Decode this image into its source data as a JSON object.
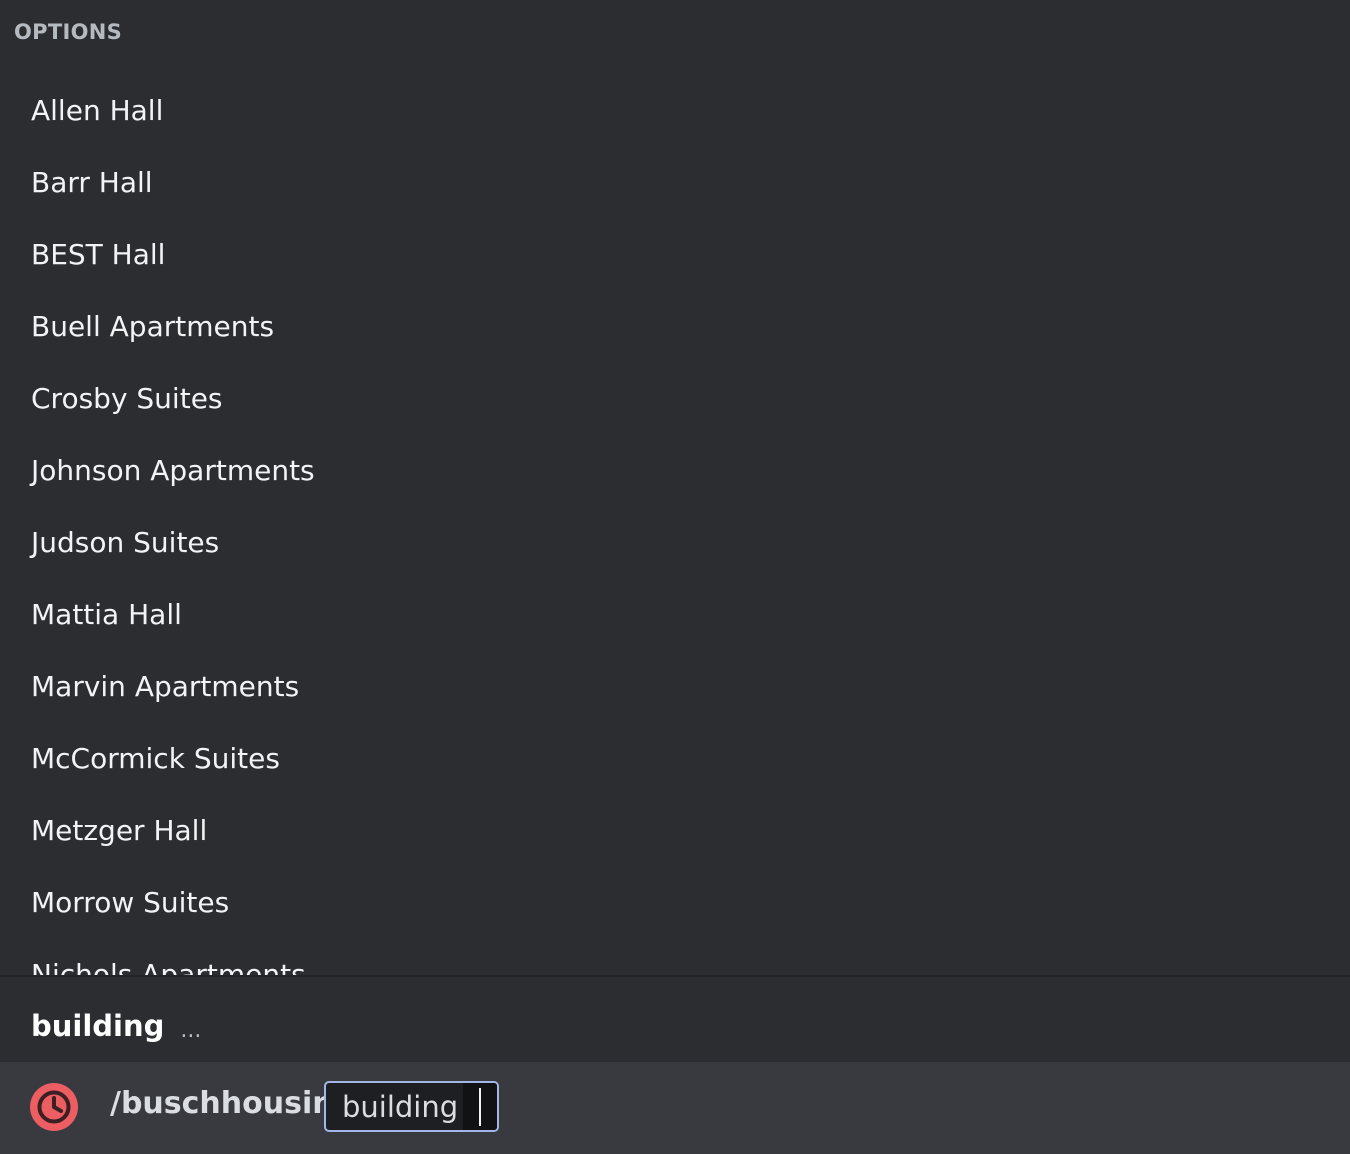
{
  "popup": {
    "section_header": "OPTIONS",
    "options": [
      "Allen Hall",
      "Barr Hall",
      "BEST Hall",
      "Buell Apartments",
      "Crosby Suites",
      "Johnson Apartments",
      "Judson Suites",
      "Mattia Hall",
      "Marvin Apartments",
      "McCormick Suites",
      "Metzger Hall",
      "Morrow Suites",
      "Nichols Apartments"
    ]
  },
  "parameter": {
    "name": "building",
    "ellipsis": "..."
  },
  "input_bar": {
    "icon": "clock-icon",
    "command": "/buschhousing",
    "option_chip_label": "building"
  },
  "colors": {
    "background": "#2b2d31",
    "input_bar": "#383a40",
    "icon_accent": "#ed5e62",
    "chip_border": "#a3b6e6"
  }
}
